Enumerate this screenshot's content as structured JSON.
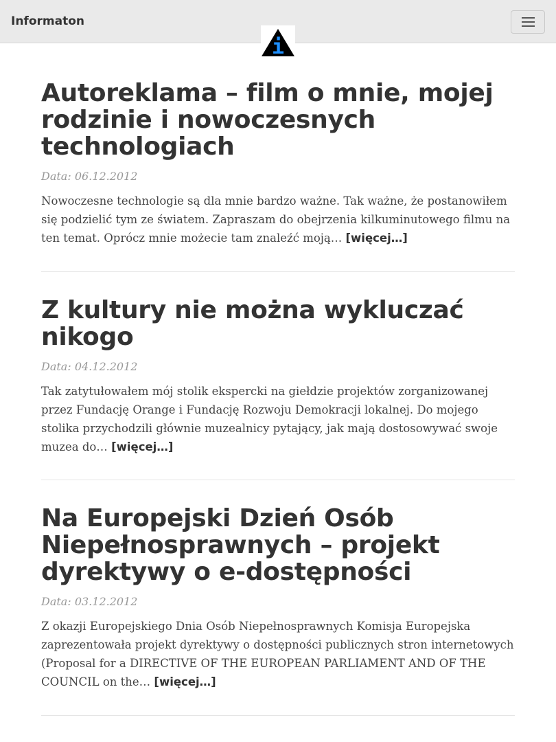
{
  "navbar": {
    "brand": "Informaton",
    "menu_icon": "hamburger-menu-icon",
    "logo_icon": "info-triangle-logo-icon",
    "logo_letter": "i",
    "colors": {
      "background": "#eaeaea",
      "logo_triangle": "#000000",
      "logo_letter": "#1e90ff"
    }
  },
  "posts": [
    {
      "title": "Autoreklama – film o mnie, mojej rodzinie i nowoczesnych technologiach",
      "date": "Data: 06.12.2012",
      "excerpt": "Nowoczesne technologie są dla mnie bardzo ważne. Tak ważne, że postanowiłem się podzielić tym ze światem. Zapraszam do obejrzenia kilkuminutowego filmu na ten temat. Oprócz mnie możecie tam znaleźć moją…",
      "more": "[więcej…]"
    },
    {
      "title": "Z kultury nie można wykluczać nikogo",
      "date": "Data: 04.12.2012",
      "excerpt": "Tak zatytułowałem mój stolik ekspercki na giełdzie projektów zorganizowanej przez Fundację Orange i Fundację Rozwoju Demokracji lokalnej. Do mojego stolika przychodzili głównie muzealnicy pytający, jak mają dostosowywać swoje muzea do…",
      "more": "[więcej…]"
    },
    {
      "title": "Na Europejski Dzień Osób Niepełnosprawnych – projekt dyrektywy o e-dostępności",
      "date": "Data: 03.12.2012",
      "excerpt": "Z okazji Europejskiego Dnia Osób Niepełnosprawnych Komisja Europejska zaprezentowała projekt dyrektywy o dostępności publicznych stron internetowych (Proposal for a DIRECTIVE OF THE EUROPEAN PARLIAMENT AND OF THE COUNCIL on the…",
      "more": "[więcej…]"
    }
  ]
}
